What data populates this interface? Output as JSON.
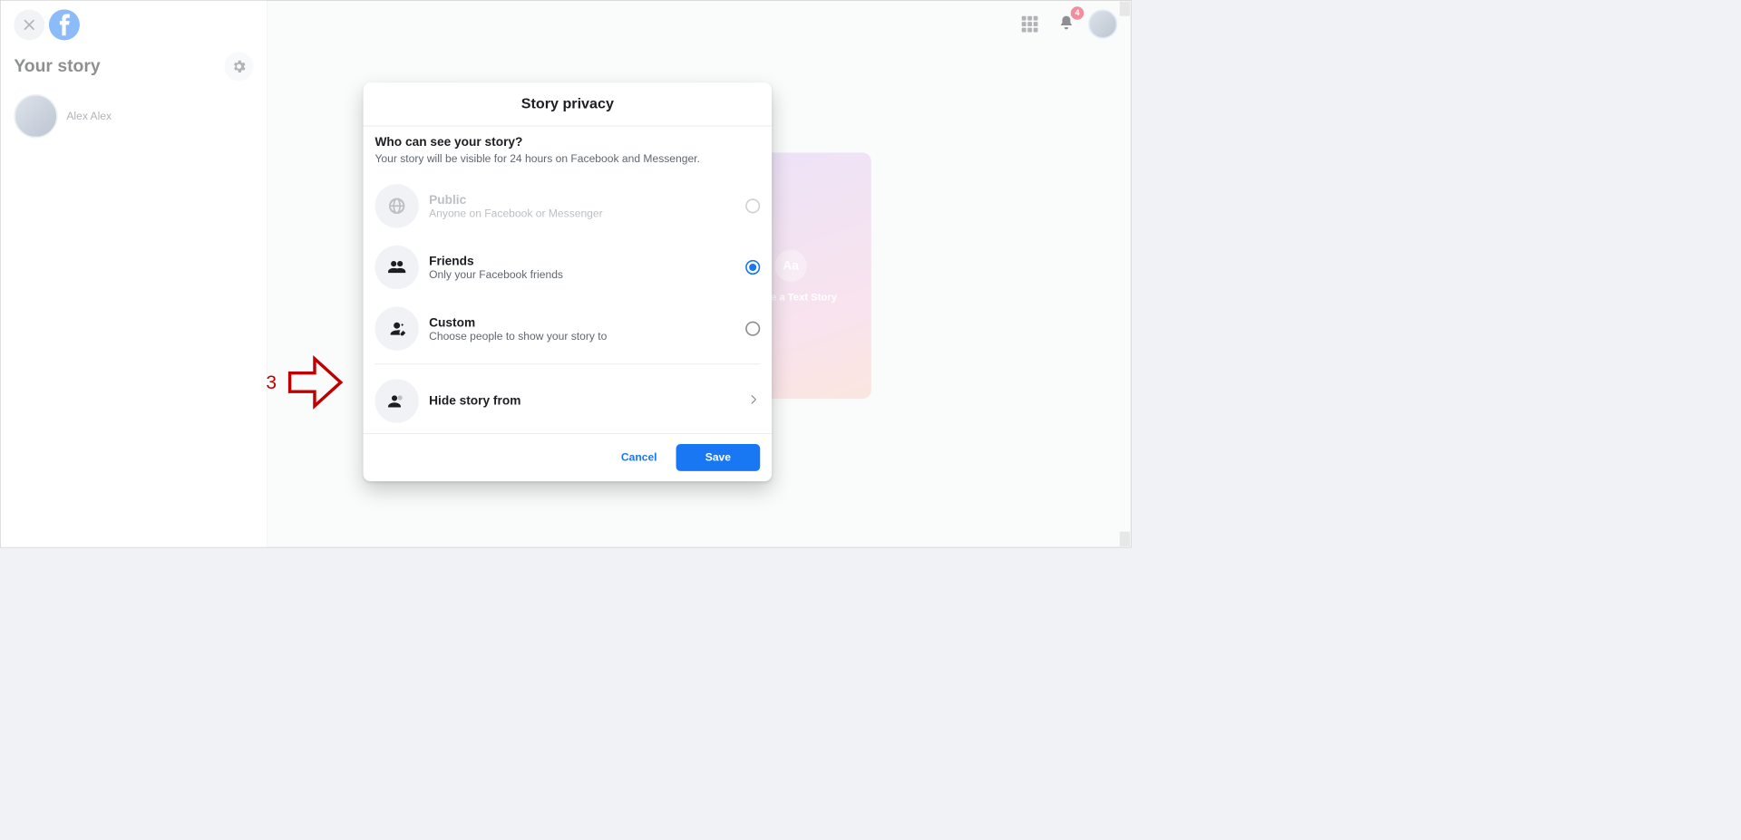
{
  "sidebar": {
    "title": "Your story",
    "user_name": "Alex Alex"
  },
  "topright": {
    "notification_count": "4"
  },
  "story_card": {
    "icon_text": "Aa",
    "label": "Create a Text Story"
  },
  "modal": {
    "title": "Story privacy",
    "question": "Who can see your story?",
    "subtext": "Your story will be visible for 24 hours on Facebook and Messenger.",
    "options": [
      {
        "title": "Public",
        "sub": "Anyone on Facebook or Messenger",
        "selected": false,
        "disabled": true
      },
      {
        "title": "Friends",
        "sub": "Only your Facebook friends",
        "selected": true,
        "disabled": false
      },
      {
        "title": "Custom",
        "sub": "Choose people to show your story to",
        "selected": false,
        "disabled": false
      }
    ],
    "hide_label": "Hide story from",
    "cancel": "Cancel",
    "save": "Save"
  },
  "annotation": {
    "step": "3"
  }
}
